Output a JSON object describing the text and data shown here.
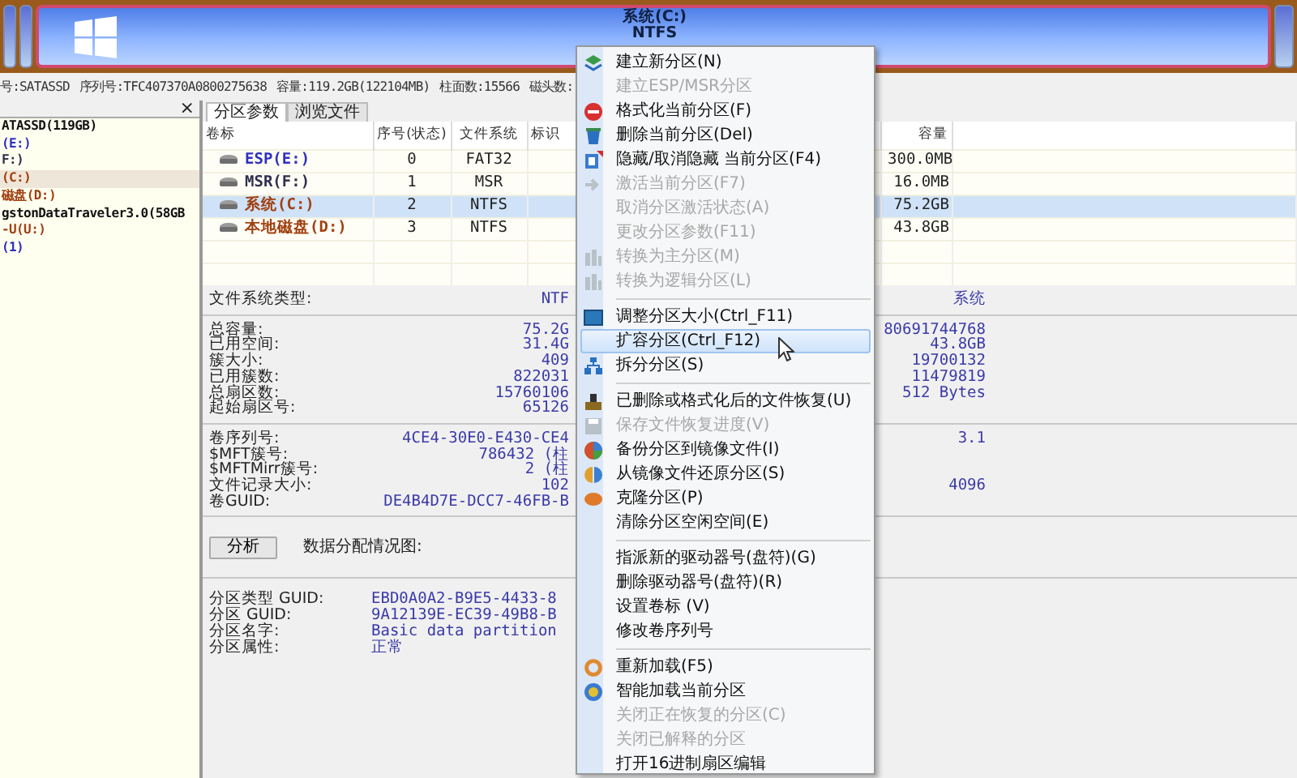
{
  "disk_map": {
    "partition_label": "系统(C:)",
    "file_system": "NTFS"
  },
  "disk_info": [
    "号:SATASSD",
    "序列号:TFC407370A0800275638",
    "容量:119.2GB(122104MB)",
    "柱面数:15566",
    "磁头数:"
  ],
  "tree": {
    "close": "×",
    "items": [
      {
        "label": "ATASSD(119GB)",
        "selected": false,
        "children": [
          {
            "label": "(E:)",
            "color": "#3030c0",
            "selected": false
          },
          {
            "label": "F:)",
            "color": "#303050",
            "selected": false
          },
          {
            "label": "(C:)",
            "color": "#a04010",
            "selected": true
          },
          {
            "label": "磁盘(D:)",
            "color": "#a04010",
            "selected": false
          }
        ]
      },
      {
        "label": "gstonDataTraveler3.0(58GB",
        "selected": false,
        "children": [
          {
            "label": "-U(U:)",
            "color": "#a04010",
            "selected": false
          },
          {
            "label": "(1)",
            "color": "#3030c0",
            "selected": false
          }
        ]
      }
    ]
  },
  "tabs": [
    {
      "label": "分区参数",
      "selected": true
    },
    {
      "label": "浏览文件",
      "selected": false
    }
  ],
  "table": {
    "columns": [
      "卷标",
      "序号(状态)",
      "文件系统",
      "标识",
      "容量"
    ],
    "rows": [
      {
        "label": "ESP(E:)",
        "index": "0",
        "file_system": "FAT32",
        "capacity": "300.0MB",
        "color": "#3030c0",
        "selected": false
      },
      {
        "label": "MSR(F:)",
        "index": "1",
        "file_system": "MSR",
        "capacity": "16.0MB",
        "color": "#303050",
        "selected": false
      },
      {
        "label": "系统(C:)",
        "index": "2",
        "file_system": "NTFS",
        "capacity": "75.2GB",
        "color": "#a04010",
        "selected": true
      },
      {
        "label": "本地磁盘(D:)",
        "index": "3",
        "file_system": "NTFS",
        "capacity": "43.8GB",
        "color": "#a04010",
        "selected": false
      }
    ]
  },
  "details": [
    {
      "rows": [
        {
          "label": "文件系统类型:",
          "value": "NTF",
          "value_2": "系统"
        }
      ]
    },
    {
      "rows": [
        {
          "label": "总容量:",
          "value": "75.2G",
          "value_2": "80691744768"
        },
        {
          "label": "已用空间:",
          "value": "31.4G",
          "value_2": "43.8GB"
        },
        {
          "label": "簇大小:",
          "value": "409",
          "value_2": "19700132"
        },
        {
          "label": "已用簇数:",
          "value": "822031",
          "value_2": "11479819"
        },
        {
          "label": "总扇区数:",
          "value": "15760106",
          "value_2": "512 Bytes"
        },
        {
          "label": "起始扇区号:",
          "value": "65126"
        }
      ]
    },
    {
      "rows": [
        {
          "label": "卷序列号:",
          "value": "4CE4-30E0-E430-CE4",
          "value_2": "3.1"
        },
        {
          "label": "$MFT簇号:",
          "value": "786432 (柱"
        },
        {
          "label": "$MFTMirr簇号:",
          "value": "2 (柱"
        },
        {
          "label": "文件记录大小:",
          "value": "102",
          "value_2": "4096"
        },
        {
          "label": "卷GUID:",
          "value": "DE4B4D7E-DCC7-46FB-B"
        }
      ]
    }
  ],
  "analyze": {
    "button": "分析",
    "label": "数据分配情况图:"
  },
  "partition_info": [
    {
      "label": "分区类型 GUID:",
      "value": "EBD0A0A2-B9E5-4433-8"
    },
    {
      "label": "分区 GUID:",
      "value": "9A12139E-EC39-49B8-B"
    },
    {
      "label": "分区名字:",
      "value": "Basic data partition"
    },
    {
      "label": "分区属性:",
      "value": "正常"
    }
  ],
  "context_menu": [
    {
      "kind": "item",
      "label": "建立新分区(N)",
      "disabled": false,
      "selected": false
    },
    {
      "kind": "item",
      "label": "建立ESP/MSR分区",
      "disabled": true,
      "selected": false
    },
    {
      "kind": "item",
      "label": "格式化当前分区(F)",
      "disabled": false,
      "selected": false
    },
    {
      "kind": "item",
      "label": "删除当前分区(Del)",
      "disabled": false,
      "selected": false
    },
    {
      "kind": "item",
      "label": "隐藏/取消隐藏 当前分区(F4)",
      "disabled": false,
      "selected": false
    },
    {
      "kind": "item",
      "label": "激活当前分区(F7)",
      "disabled": true,
      "selected": false
    },
    {
      "kind": "item",
      "label": "取消分区激活状态(A)",
      "disabled": true,
      "selected": false
    },
    {
      "kind": "item",
      "label": "更改分区参数(F11)",
      "disabled": true,
      "selected": false
    },
    {
      "kind": "item",
      "label": "转换为主分区(M)",
      "disabled": true,
      "selected": false
    },
    {
      "kind": "item",
      "label": "转换为逻辑分区(L)",
      "disabled": true,
      "selected": false
    },
    {
      "kind": "separator"
    },
    {
      "kind": "item",
      "label": "调整分区大小(Ctrl_F11)",
      "disabled": false,
      "selected": false
    },
    {
      "kind": "item",
      "label": "扩容分区(Ctrl_F12)",
      "disabled": false,
      "selected": true
    },
    {
      "kind": "item",
      "label": "拆分分区(S)",
      "disabled": false,
      "selected": false
    },
    {
      "kind": "separator"
    },
    {
      "kind": "item",
      "label": "已删除或格式化后的文件恢复(U)",
      "disabled": false,
      "selected": false
    },
    {
      "kind": "item",
      "label": "保存文件恢复进度(V)",
      "disabled": true,
      "selected": false
    },
    {
      "kind": "item",
      "label": "备份分区到镜像文件(I)",
      "disabled": false,
      "selected": false
    },
    {
      "kind": "item",
      "label": "从镜像文件还原分区(S)",
      "disabled": false,
      "selected": false
    },
    {
      "kind": "item",
      "label": "克隆分区(P)",
      "disabled": false,
      "selected": false
    },
    {
      "kind": "item",
      "label": "清除分区空闲空间(E)",
      "disabled": false,
      "selected": false
    },
    {
      "kind": "separator"
    },
    {
      "kind": "item",
      "label": "指派新的驱动器号(盘符)(G)",
      "disabled": false,
      "selected": false
    },
    {
      "kind": "item",
      "label": "删除驱动器号(盘符)(R)",
      "disabled": false,
      "selected": false
    },
    {
      "kind": "item",
      "label": "设置卷标 (V)",
      "disabled": false,
      "selected": false
    },
    {
      "kind": "item",
      "label": "修改卷序列号",
      "disabled": false,
      "selected": false
    },
    {
      "kind": "separator"
    },
    {
      "kind": "item",
      "label": "重新加载(F5)",
      "disabled": false,
      "selected": false
    },
    {
      "kind": "item",
      "label": "智能加载当前分区",
      "disabled": false,
      "selected": false
    },
    {
      "kind": "item",
      "label": "关闭正在恢复的分区(C)",
      "disabled": true,
      "selected": false
    },
    {
      "kind": "item",
      "label": "关闭已解释的分区",
      "disabled": true,
      "selected": false
    },
    {
      "kind": "item",
      "label": "打开16进制扇区编辑",
      "disabled": false,
      "selected": false
    }
  ]
}
